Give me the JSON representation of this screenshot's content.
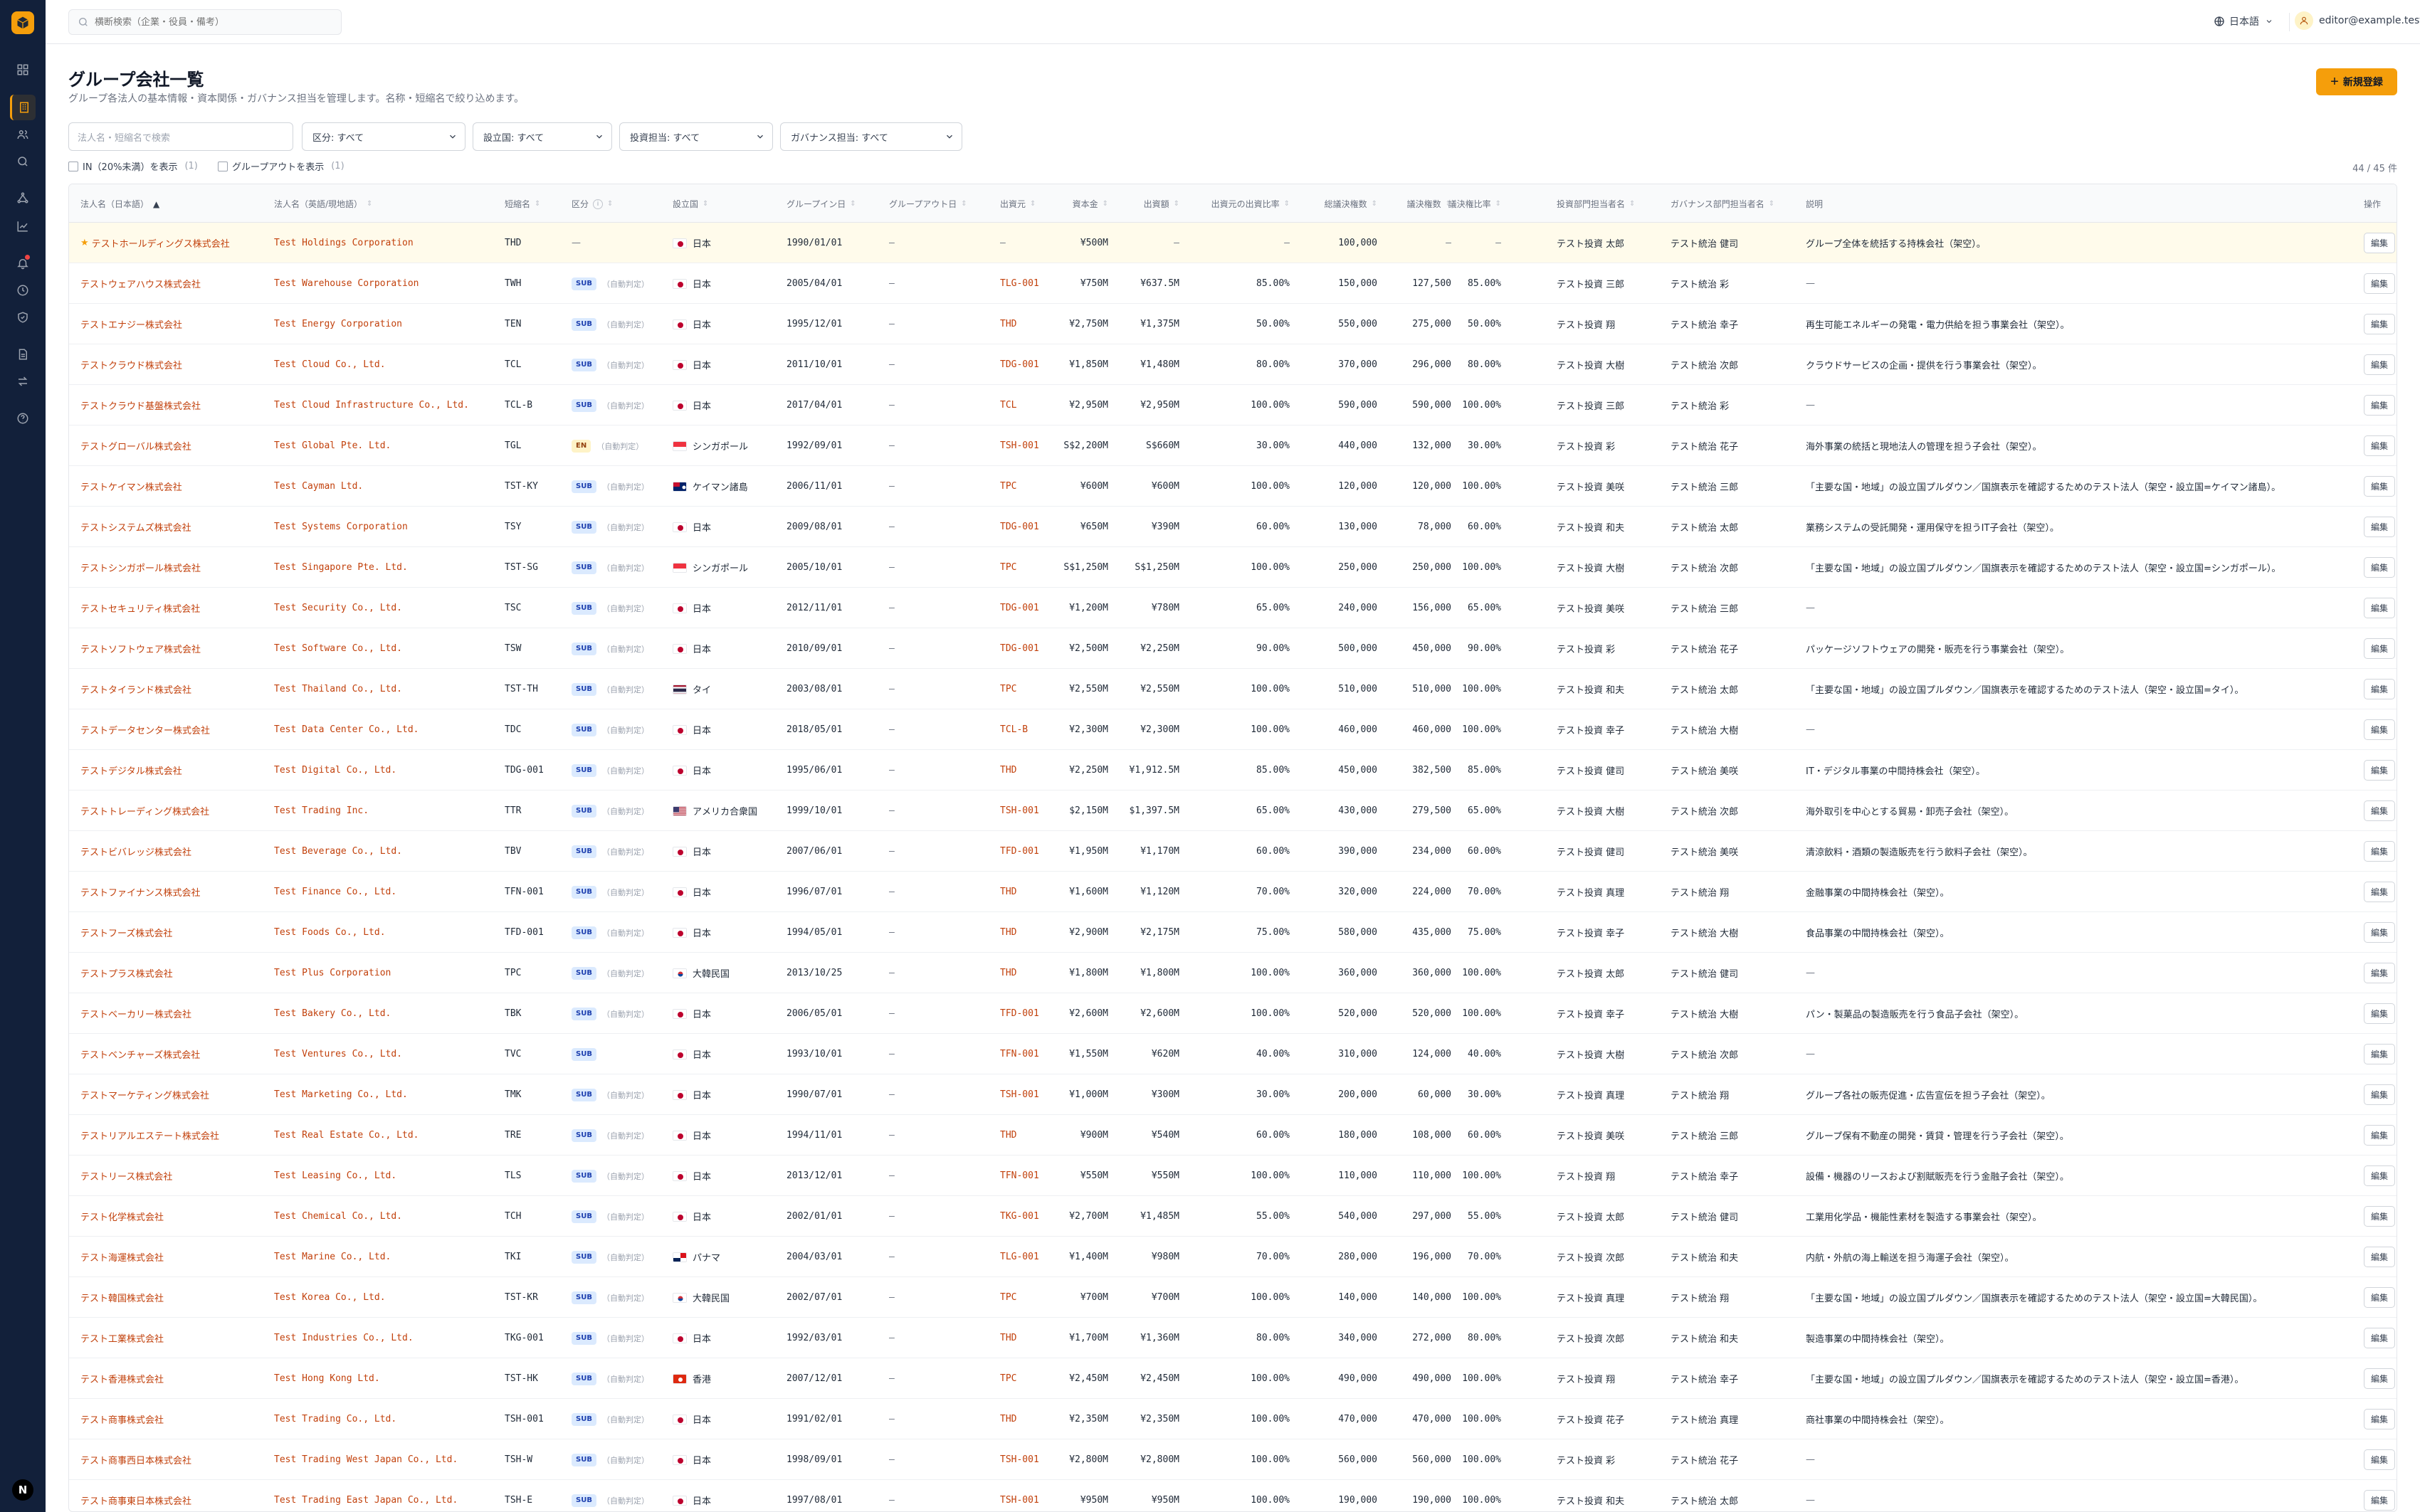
{
  "topbar": {
    "search_placeholder": "横断検索（企業・役員・備考）",
    "language": "日本語",
    "user_email": "editor@example.test"
  },
  "sidebar": {
    "user_initial": "N",
    "items": [
      "dashboard-icon",
      "building-icon",
      "users-icon",
      "search-icon",
      "network-icon",
      "chart-icon",
      "bell-icon",
      "clock-icon",
      "shield-icon",
      "document-icon",
      "swap-icon",
      "help-icon"
    ]
  },
  "page": {
    "title": "グループ会社一覧",
    "description": "グループ各法人の基本情報・資本関係・ガバナンス担当を管理します。名称・短縮名で絞り込めます。",
    "new_button": "新規登録"
  },
  "filters": {
    "name_placeholder": "法人名・短縮名で検索",
    "category": "区分: すべて",
    "country": "設立国: すべて",
    "investment": "投資担当: すべて",
    "governance": "ガバナンス担当: すべて",
    "show_in_label": "IN（20%未満）を表示",
    "show_in_count": "(1)",
    "show_out_label": "グループアウトを表示",
    "show_out_count": "(1)",
    "result_count": "44 / 45 件"
  },
  "table": {
    "columns": [
      "法人名（日本語）",
      "法人名（英語/現地語）",
      "短縮名",
      "区分",
      "設立国",
      "グループイン日",
      "グループアウト日",
      "出資元",
      "資本金",
      "出資額",
      "出資元の出資比率",
      "総議決権数",
      "議決権数",
      "議決権比率",
      "投資部門担当者名",
      "ガバナンス部門担当者名",
      "説明",
      "操作"
    ],
    "edit_label": "編集",
    "rows": [
      {
        "ja": "テストホールディングス株式会社",
        "en": "Test Holdings Corporation",
        "short": "THD",
        "cat": "",
        "note": "",
        "country": "日本",
        "flag": "jp",
        "in": "1990/01/01",
        "out": "—",
        "parent": "—",
        "capital": "¥500M",
        "invest": "—",
        "ratio": "—",
        "total": "100,000",
        "votes": "—",
        "vratio": "—",
        "inv": "テスト投資 太郎",
        "gov": "テスト統治 健司",
        "desc": "グループ全体を統括する持株会社（架空）。",
        "star": true
      },
      {
        "ja": "テストウェアハウス株式会社",
        "en": "Test Warehouse Corporation",
        "short": "TWH",
        "cat": "SUB",
        "note": "（自動判定）",
        "country": "日本",
        "flag": "jp",
        "in": "2005/04/01",
        "out": "—",
        "parent": "TLG-001",
        "capital": "¥750M",
        "invest": "¥637.5M",
        "ratio": "85.00%",
        "total": "150,000",
        "votes": "127,500",
        "vratio": "85.00%",
        "inv": "テスト投資 三郎",
        "gov": "テスト統治 彩",
        "desc": "—"
      },
      {
        "ja": "テストエナジー株式会社",
        "en": "Test Energy Corporation",
        "short": "TEN",
        "cat": "SUB",
        "note": "（自動判定）",
        "country": "日本",
        "flag": "jp",
        "in": "1995/12/01",
        "out": "—",
        "parent": "THD",
        "capital": "¥2,750M",
        "invest": "¥1,375M",
        "ratio": "50.00%",
        "total": "550,000",
        "votes": "275,000",
        "vratio": "50.00%",
        "inv": "テスト投資 翔",
        "gov": "テスト統治 幸子",
        "desc": "再生可能エネルギーの発電・電力供給を担う事業会社（架空）。"
      },
      {
        "ja": "テストクラウド株式会社",
        "en": "Test Cloud Co., Ltd.",
        "short": "TCL",
        "cat": "SUB",
        "note": "（自動判定）",
        "country": "日本",
        "flag": "jp",
        "in": "2011/10/01",
        "out": "—",
        "parent": "TDG-001",
        "capital": "¥1,850M",
        "invest": "¥1,480M",
        "ratio": "80.00%",
        "total": "370,000",
        "votes": "296,000",
        "vratio": "80.00%",
        "inv": "テスト投資 大樹",
        "gov": "テスト統治 次郎",
        "desc": "クラウドサービスの企画・提供を行う事業会社（架空）。"
      },
      {
        "ja": "テストクラウド基盤株式会社",
        "en": "Test Cloud Infrastructure Co., Ltd.",
        "short": "TCL-B",
        "cat": "SUB",
        "note": "（自動判定）",
        "country": "日本",
        "flag": "jp",
        "in": "2017/04/01",
        "out": "—",
        "parent": "TCL",
        "capital": "¥2,950M",
        "invest": "¥2,950M",
        "ratio": "100.00%",
        "total": "590,000",
        "votes": "590,000",
        "vratio": "100.00%",
        "inv": "テスト投資 三郎",
        "gov": "テスト統治 彩",
        "desc": "—"
      },
      {
        "ja": "テストグローバル株式会社",
        "en": "Test Global Pte. Ltd.",
        "short": "TGL",
        "cat": "EN",
        "note": "（自動判定）",
        "country": "シンガポール",
        "flag": "sg",
        "in": "1992/09/01",
        "out": "—",
        "parent": "TSH-001",
        "capital": "S$2,200M",
        "invest": "S$660M",
        "ratio": "30.00%",
        "total": "440,000",
        "votes": "132,000",
        "vratio": "30.00%",
        "inv": "テスト投資 彩",
        "gov": "テスト統治 花子",
        "desc": "海外事業の統括と現地法人の管理を担う子会社（架空）。"
      },
      {
        "ja": "テストケイマン株式会社",
        "en": "Test Cayman Ltd.",
        "short": "TST-KY",
        "cat": "SUB",
        "note": "（自動判定）",
        "country": "ケイマン諸島",
        "flag": "ky",
        "in": "2006/11/01",
        "out": "—",
        "parent": "TPC",
        "capital": "¥600M",
        "invest": "¥600M",
        "ratio": "100.00%",
        "total": "120,000",
        "votes": "120,000",
        "vratio": "100.00%",
        "inv": "テスト投資 美咲",
        "gov": "テスト統治 三郎",
        "desc": "「主要な国・地域」の設立国プルダウン／国旗表示を確認するためのテスト法人（架空・設立国=ケイマン諸島）。"
      },
      {
        "ja": "テストシステムズ株式会社",
        "en": "Test Systems Corporation",
        "short": "TSY",
        "cat": "SUB",
        "note": "（自動判定）",
        "country": "日本",
        "flag": "jp",
        "in": "2009/08/01",
        "out": "—",
        "parent": "TDG-001",
        "capital": "¥650M",
        "invest": "¥390M",
        "ratio": "60.00%",
        "total": "130,000",
        "votes": "78,000",
        "vratio": "60.00%",
        "inv": "テスト投資 和夫",
        "gov": "テスト統治 太郎",
        "desc": "業務システムの受託開発・運用保守を担うIT子会社（架空）。"
      },
      {
        "ja": "テストシンガポール株式会社",
        "en": "Test Singapore Pte. Ltd.",
        "short": "TST-SG",
        "cat": "SUB",
        "note": "（自動判定）",
        "country": "シンガポール",
        "flag": "sg",
        "in": "2005/10/01",
        "out": "—",
        "parent": "TPC",
        "capital": "S$1,250M",
        "invest": "S$1,250M",
        "ratio": "100.00%",
        "total": "250,000",
        "votes": "250,000",
        "vratio": "100.00%",
        "inv": "テスト投資 大樹",
        "gov": "テスト統治 次郎",
        "desc": "「主要な国・地域」の設立国プルダウン／国旗表示を確認するためのテスト法人（架空・設立国=シンガポール）。"
      },
      {
        "ja": "テストセキュリティ株式会社",
        "en": "Test Security Co., Ltd.",
        "short": "TSC",
        "cat": "SUB",
        "note": "（自動判定）",
        "country": "日本",
        "flag": "jp",
        "in": "2012/11/01",
        "out": "—",
        "parent": "TDG-001",
        "capital": "¥1,200M",
        "invest": "¥780M",
        "ratio": "65.00%",
        "total": "240,000",
        "votes": "156,000",
        "vratio": "65.00%",
        "inv": "テスト投資 美咲",
        "gov": "テスト統治 三郎",
        "desc": "—"
      },
      {
        "ja": "テストソフトウェア株式会社",
        "en": "Test Software Co., Ltd.",
        "short": "TSW",
        "cat": "SUB",
        "note": "（自動判定）",
        "country": "日本",
        "flag": "jp",
        "in": "2010/09/01",
        "out": "—",
        "parent": "TDG-001",
        "capital": "¥2,500M",
        "invest": "¥2,250M",
        "ratio": "90.00%",
        "total": "500,000",
        "votes": "450,000",
        "vratio": "90.00%",
        "inv": "テスト投資 彩",
        "gov": "テスト統治 花子",
        "desc": "パッケージソフトウェアの開発・販売を行う事業会社（架空）。"
      },
      {
        "ja": "テストタイランド株式会社",
        "en": "Test Thailand Co., Ltd.",
        "short": "TST-TH",
        "cat": "SUB",
        "note": "（自動判定）",
        "country": "タイ",
        "flag": "th",
        "in": "2003/08/01",
        "out": "—",
        "parent": "TPC",
        "capital": "¥2,550M",
        "invest": "¥2,550M",
        "ratio": "100.00%",
        "total": "510,000",
        "votes": "510,000",
        "vratio": "100.00%",
        "inv": "テスト投資 和夫",
        "gov": "テスト統治 太郎",
        "desc": "「主要な国・地域」の設立国プルダウン／国旗表示を確認するためのテスト法人（架空・設立国=タイ）。"
      },
      {
        "ja": "テストデータセンター株式会社",
        "en": "Test Data Center Co., Ltd.",
        "short": "TDC",
        "cat": "SUB",
        "note": "（自動判定）",
        "country": "日本",
        "flag": "jp",
        "in": "2018/05/01",
        "out": "—",
        "parent": "TCL-B",
        "capital": "¥2,300M",
        "invest": "¥2,300M",
        "ratio": "100.00%",
        "total": "460,000",
        "votes": "460,000",
        "vratio": "100.00%",
        "inv": "テスト投資 幸子",
        "gov": "テスト統治 大樹",
        "desc": "—"
      },
      {
        "ja": "テストデジタル株式会社",
        "en": "Test Digital Co., Ltd.",
        "short": "TDG-001",
        "cat": "SUB",
        "note": "（自動判定）",
        "country": "日本",
        "flag": "jp",
        "in": "1995/06/01",
        "out": "—",
        "parent": "THD",
        "capital": "¥2,250M",
        "invest": "¥1,912.5M",
        "ratio": "85.00%",
        "total": "450,000",
        "votes": "382,500",
        "vratio": "85.00%",
        "inv": "テスト投資 健司",
        "gov": "テスト統治 美咲",
        "desc": "IT・デジタル事業の中間持株会社（架空）。"
      },
      {
        "ja": "テストトレーディング株式会社",
        "en": "Test Trading Inc.",
        "short": "TTR",
        "cat": "SUB",
        "note": "（自動判定）",
        "country": "アメリカ合衆国",
        "flag": "us",
        "in": "1999/10/01",
        "out": "—",
        "parent": "TSH-001",
        "capital": "$2,150M",
        "invest": "$1,397.5M",
        "ratio": "65.00%",
        "total": "430,000",
        "votes": "279,500",
        "vratio": "65.00%",
        "inv": "テスト投資 大樹",
        "gov": "テスト統治 次郎",
        "desc": "海外取引を中心とする貿易・卸売子会社（架空）。"
      },
      {
        "ja": "テストビバレッジ株式会社",
        "en": "Test Beverage Co., Ltd.",
        "short": "TBV",
        "cat": "SUB",
        "note": "（自動判定）",
        "country": "日本",
        "flag": "jp",
        "in": "2007/06/01",
        "out": "—",
        "parent": "TFD-001",
        "capital": "¥1,950M",
        "invest": "¥1,170M",
        "ratio": "60.00%",
        "total": "390,000",
        "votes": "234,000",
        "vratio": "60.00%",
        "inv": "テスト投資 健司",
        "gov": "テスト統治 美咲",
        "desc": "清涼飲料・酒類の製造販売を行う飲料子会社（架空）。"
      },
      {
        "ja": "テストファイナンス株式会社",
        "en": "Test Finance Co., Ltd.",
        "short": "TFN-001",
        "cat": "SUB",
        "note": "（自動判定）",
        "country": "日本",
        "flag": "jp",
        "in": "1996/07/01",
        "out": "—",
        "parent": "THD",
        "capital": "¥1,600M",
        "invest": "¥1,120M",
        "ratio": "70.00%",
        "total": "320,000",
        "votes": "224,000",
        "vratio": "70.00%",
        "inv": "テスト投資 真理",
        "gov": "テスト統治 翔",
        "desc": "金融事業の中間持株会社（架空）。"
      },
      {
        "ja": "テストフーズ株式会社",
        "en": "Test Foods Co., Ltd.",
        "short": "TFD-001",
        "cat": "SUB",
        "note": "（自動判定）",
        "country": "日本",
        "flag": "jp",
        "in": "1994/05/01",
        "out": "—",
        "parent": "THD",
        "capital": "¥2,900M",
        "invest": "¥2,175M",
        "ratio": "75.00%",
        "total": "580,000",
        "votes": "435,000",
        "vratio": "75.00%",
        "inv": "テスト投資 幸子",
        "gov": "テスト統治 大樹",
        "desc": "食品事業の中間持株会社（架空）。"
      },
      {
        "ja": "テストプラス株式会社",
        "en": "Test Plus Corporation",
        "short": "TPC",
        "cat": "SUB",
        "note": "（自動判定）",
        "country": "大韓民国",
        "flag": "kr",
        "in": "2013/10/25",
        "out": "—",
        "parent": "THD",
        "capital": "¥1,800M",
        "invest": "¥1,800M",
        "ratio": "100.00%",
        "total": "360,000",
        "votes": "360,000",
        "vratio": "100.00%",
        "inv": "テスト投資 太郎",
        "gov": "テスト統治 健司",
        "desc": "—"
      },
      {
        "ja": "テストベーカリー株式会社",
        "en": "Test Bakery Co., Ltd.",
        "short": "TBK",
        "cat": "SUB",
        "note": "（自動判定）",
        "country": "日本",
        "flag": "jp",
        "in": "2006/05/01",
        "out": "—",
        "parent": "TFD-001",
        "capital": "¥2,600M",
        "invest": "¥2,600M",
        "ratio": "100.00%",
        "total": "520,000",
        "votes": "520,000",
        "vratio": "100.00%",
        "inv": "テスト投資 幸子",
        "gov": "テスト統治 大樹",
        "desc": "パン・製菓品の製造販売を行う食品子会社（架空）。"
      },
      {
        "ja": "テストベンチャーズ株式会社",
        "en": "Test Ventures Co., Ltd.",
        "short": "TVC",
        "cat": "SUB",
        "note": "",
        "country": "日本",
        "flag": "jp",
        "in": "1993/10/01",
        "out": "—",
        "parent": "TFN-001",
        "capital": "¥1,550M",
        "invest": "¥620M",
        "ratio": "40.00%",
        "total": "310,000",
        "votes": "124,000",
        "vratio": "40.00%",
        "inv": "テスト投資 大樹",
        "gov": "テスト統治 次郎",
        "desc": "—"
      },
      {
        "ja": "テストマーケティング株式会社",
        "en": "Test Marketing Co., Ltd.",
        "short": "TMK",
        "cat": "SUB",
        "note": "（自動判定）",
        "country": "日本",
        "flag": "jp",
        "in": "1990/07/01",
        "out": "—",
        "parent": "TSH-001",
        "capital": "¥1,000M",
        "invest": "¥300M",
        "ratio": "30.00%",
        "total": "200,000",
        "votes": "60,000",
        "vratio": "30.00%",
        "inv": "テスト投資 真理",
        "gov": "テスト統治 翔",
        "desc": "グループ各社の販売促進・広告宣伝を担う子会社（架空）。"
      },
      {
        "ja": "テストリアルエステート株式会社",
        "en": "Test Real Estate Co., Ltd.",
        "short": "TRE",
        "cat": "SUB",
        "note": "（自動判定）",
        "country": "日本",
        "flag": "jp",
        "in": "1994/11/01",
        "out": "—",
        "parent": "THD",
        "capital": "¥900M",
        "invest": "¥540M",
        "ratio": "60.00%",
        "total": "180,000",
        "votes": "108,000",
        "vratio": "60.00%",
        "inv": "テスト投資 美咲",
        "gov": "テスト統治 三郎",
        "desc": "グループ保有不動産の開発・賃貸・管理を行う子会社（架空）。"
      },
      {
        "ja": "テストリース株式会社",
        "en": "Test Leasing Co., Ltd.",
        "short": "TLS",
        "cat": "SUB",
        "note": "（自動判定）",
        "country": "日本",
        "flag": "jp",
        "in": "2013/12/01",
        "out": "—",
        "parent": "TFN-001",
        "capital": "¥550M",
        "invest": "¥550M",
        "ratio": "100.00%",
        "total": "110,000",
        "votes": "110,000",
        "vratio": "100.00%",
        "inv": "テスト投資 翔",
        "gov": "テスト統治 幸子",
        "desc": "設備・機器のリースおよび割賦販売を行う金融子会社（架空）。"
      },
      {
        "ja": "テスト化学株式会社",
        "en": "Test Chemical Co., Ltd.",
        "short": "TCH",
        "cat": "SUB",
        "note": "（自動判定）",
        "country": "日本",
        "flag": "jp",
        "in": "2002/01/01",
        "out": "—",
        "parent": "TKG-001",
        "capital": "¥2,700M",
        "invest": "¥1,485M",
        "ratio": "55.00%",
        "total": "540,000",
        "votes": "297,000",
        "vratio": "55.00%",
        "inv": "テスト投資 太郎",
        "gov": "テスト統治 健司",
        "desc": "工業用化学品・機能性素材を製造する事業会社（架空）。"
      },
      {
        "ja": "テスト海運株式会社",
        "en": "Test Marine Co., Ltd.",
        "short": "TKI",
        "cat": "SUB",
        "note": "（自動判定）",
        "country": "パナマ",
        "flag": "pa",
        "in": "2004/03/01",
        "out": "—",
        "parent": "TLG-001",
        "capital": "¥1,400M",
        "invest": "¥980M",
        "ratio": "70.00%",
        "total": "280,000",
        "votes": "196,000",
        "vratio": "70.00%",
        "inv": "テスト投資 次郎",
        "gov": "テスト統治 和夫",
        "desc": "内航・外航の海上輸送を担う海運子会社（架空）。"
      },
      {
        "ja": "テスト韓国株式会社",
        "en": "Test Korea Co., Ltd.",
        "short": "TST-KR",
        "cat": "SUB",
        "note": "（自動判定）",
        "country": "大韓民国",
        "flag": "kr",
        "in": "2002/07/01",
        "out": "—",
        "parent": "TPC",
        "capital": "¥700M",
        "invest": "¥700M",
        "ratio": "100.00%",
        "total": "140,000",
        "votes": "140,000",
        "vratio": "100.00%",
        "inv": "テスト投資 真理",
        "gov": "テスト統治 翔",
        "desc": "「主要な国・地域」の設立国プルダウン／国旗表示を確認するためのテスト法人（架空・設立国=大韓民国）。"
      },
      {
        "ja": "テスト工業株式会社",
        "en": "Test Industries Co., Ltd.",
        "short": "TKG-001",
        "cat": "SUB",
        "note": "（自動判定）",
        "country": "日本",
        "flag": "jp",
        "in": "1992/03/01",
        "out": "—",
        "parent": "THD",
        "capital": "¥1,700M",
        "invest": "¥1,360M",
        "ratio": "80.00%",
        "total": "340,000",
        "votes": "272,000",
        "vratio": "80.00%",
        "inv": "テスト投資 次郎",
        "gov": "テスト統治 和夫",
        "desc": "製造事業の中間持株会社（架空）。"
      },
      {
        "ja": "テスト香港株式会社",
        "en": "Test Hong Kong Ltd.",
        "short": "TST-HK",
        "cat": "SUB",
        "note": "（自動判定）",
        "country": "香港",
        "flag": "hk",
        "in": "2007/12/01",
        "out": "—",
        "parent": "TPC",
        "capital": "¥2,450M",
        "invest": "¥2,450M",
        "ratio": "100.00%",
        "total": "490,000",
        "votes": "490,000",
        "vratio": "100.00%",
        "inv": "テスト投資 翔",
        "gov": "テスト統治 幸子",
        "desc": "「主要な国・地域」の設立国プルダウン／国旗表示を確認するためのテスト法人（架空・設立国=香港）。"
      },
      {
        "ja": "テスト商事株式会社",
        "en": "Test Trading Co., Ltd.",
        "short": "TSH-001",
        "cat": "SUB",
        "note": "（自動判定）",
        "country": "日本",
        "flag": "jp",
        "in": "1991/02/01",
        "out": "—",
        "parent": "THD",
        "capital": "¥2,350M",
        "invest": "¥2,350M",
        "ratio": "100.00%",
        "total": "470,000",
        "votes": "470,000",
        "vratio": "100.00%",
        "inv": "テスト投資 花子",
        "gov": "テスト統治 真理",
        "desc": "商社事業の中間持株会社（架空）。"
      },
      {
        "ja": "テスト商事西日本株式会社",
        "en": "Test Trading West Japan Co., Ltd.",
        "short": "TSH-W",
        "cat": "SUB",
        "note": "（自動判定）",
        "country": "日本",
        "flag": "jp",
        "in": "1998/09/01",
        "out": "—",
        "parent": "TSH-001",
        "capital": "¥2,800M",
        "invest": "¥2,800M",
        "ratio": "100.00%",
        "total": "560,000",
        "votes": "560,000",
        "vratio": "100.00%",
        "inv": "テスト投資 彩",
        "gov": "テスト統治 花子",
        "desc": "—"
      },
      {
        "ja": "テスト商事東日本株式会社",
        "en": "Test Trading East Japan Co., Ltd.",
        "short": "TSH-E",
        "cat": "SUB",
        "note": "（自動判定）",
        "country": "日本",
        "flag": "jp",
        "in": "1997/08/01",
        "out": "—",
        "parent": "TSH-001",
        "capital": "¥950M",
        "invest": "¥950M",
        "ratio": "100.00%",
        "total": "190,000",
        "votes": "190,000",
        "vratio": "100.00%",
        "inv": "テスト投資 和夫",
        "gov": "テスト統治 太郎",
        "desc": "—"
      }
    ]
  }
}
